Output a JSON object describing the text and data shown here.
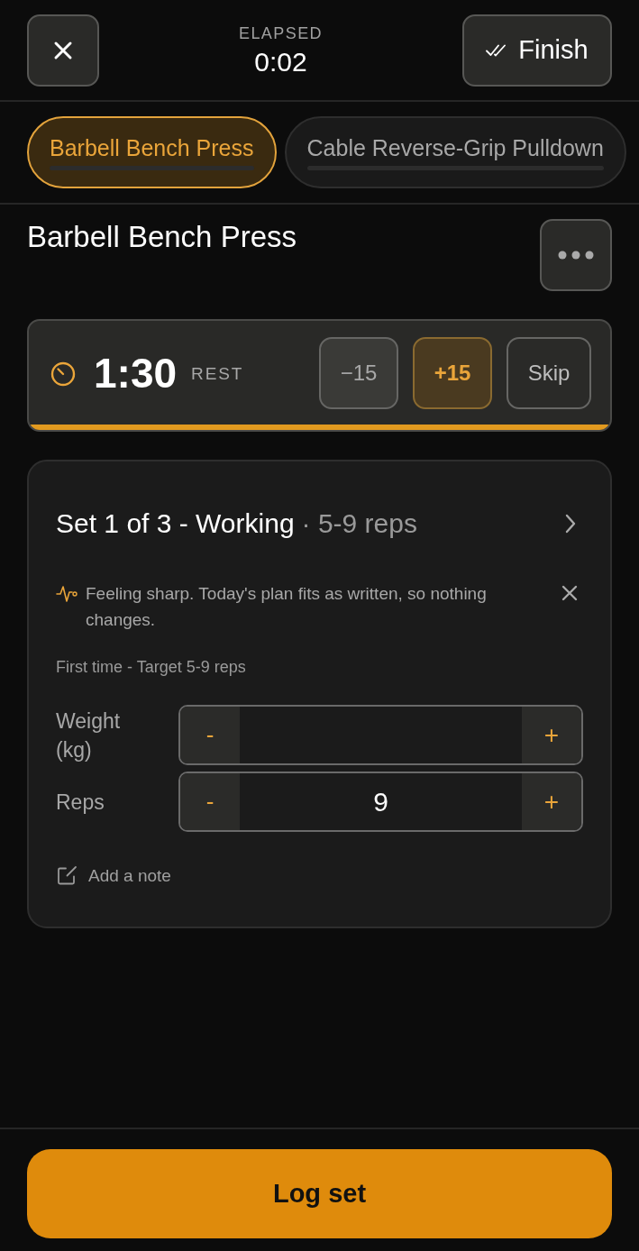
{
  "header": {
    "elapsed_label": "ELAPSED",
    "elapsed": "0:02",
    "finish": "Finish"
  },
  "exercise_tabs": [
    {
      "label": "Barbell Bench Press",
      "selected": true
    },
    {
      "label": "Cable Reverse-Grip Pulldown",
      "selected": false
    }
  ],
  "exercise": {
    "title": "Barbell Bench Press"
  },
  "rest_timer": {
    "time": "1:30",
    "label": "REST",
    "level": 1,
    "buttons": [
      {
        "label": "−15",
        "kind": "minus"
      },
      {
        "label": "+15",
        "kind": "plus"
      },
      {
        "label": "Skip",
        "kind": "skip"
      }
    ]
  },
  "set_card": {
    "title": "Set 1 of 3 - Working",
    "detail": "· 5-9 reps",
    "notice": "Feeling sharp. Today's plan fits as written, so nothing changes.",
    "history": "First time - Target 5-9 reps",
    "fields": [
      {
        "label": "Weight (kg)",
        "decrement": "-",
        "increment": "+"
      },
      {
        "label": "Reps",
        "value": "9",
        "decrement": "-",
        "increment": "+"
      }
    ],
    "add_note": "Add a note"
  },
  "log_button": "Log set"
}
